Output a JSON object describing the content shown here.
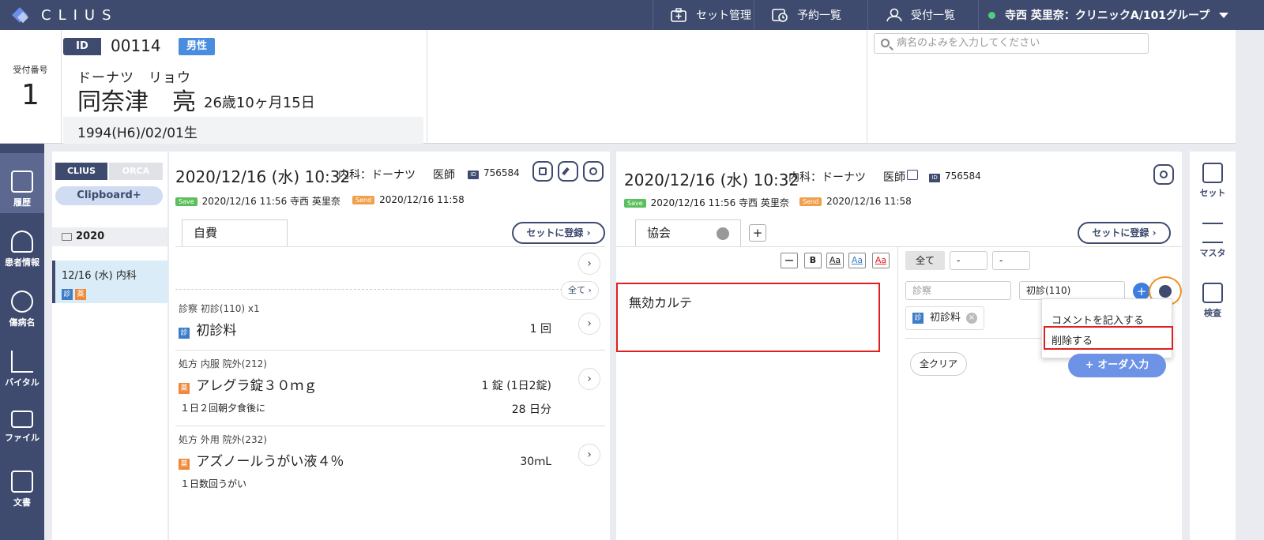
{
  "app": {
    "logo_text": "CLIUS"
  },
  "topnav": {
    "set_label": "セット管理",
    "yoyaku_label": "予約一覧",
    "uketsuke_label": "受付一覧",
    "user_label": "寺西 英里奈：クリニックA/101グループ"
  },
  "header": {
    "reception_label": "受付番号",
    "reception_number": "1",
    "id_label": "ID",
    "patient_id": "00114",
    "sex": "男性",
    "name_kana": "ドーナツ　リョウ",
    "name_kanji": "同奈津　亮",
    "age": "26歳10ヶ月15日",
    "dob": "1994(H6)/02/01生",
    "search_placeholder": "病名のよみを入力してください"
  },
  "left_sidebar": {
    "items": [
      {
        "label": "履歴",
        "icon": "history-icon"
      },
      {
        "label": "患者情報",
        "icon": "patient-info-icon"
      },
      {
        "label": "傷病名",
        "icon": "disease-icon"
      },
      {
        "label": "バイタル",
        "icon": "vitals-icon"
      },
      {
        "label": "ファイル",
        "icon": "folder-icon"
      },
      {
        "label": "文書",
        "icon": "document-icon"
      }
    ]
  },
  "history": {
    "tab_clius": "CLIUS",
    "tab_orca": "ORCA",
    "clipboard_label": "Clipboard+",
    "year": "2020",
    "entry_label": "12/16 (水) 内科",
    "badge_shin": "診",
    "badge_yaku": "薬"
  },
  "center": {
    "datetime": "2020/12/16 (水) 10:32",
    "dept": "内科：ドーナツ",
    "doctor": "医師",
    "id_badge": "ID",
    "id_value": "756584",
    "save_tag": "Save",
    "save_info": "2020/12/16 11:56 寺西 英里奈",
    "send_tag": "Send",
    "send_info": "2020/12/16 11:58",
    "insurance_tab": "自費",
    "register_set_label": "セットに登録",
    "all_label": "全て",
    "orders": [
      {
        "category": "診察 初診(110) x1",
        "badge": "診",
        "name": "初診料",
        "qty": "1 回",
        "note": "",
        "days": ""
      },
      {
        "category": "処方 内服 院外(212)",
        "badge": "薬",
        "name": "アレグラ錠３０ｍｇ",
        "qty": "1 錠 (1日2錠)",
        "note": "１日２回朝夕食後に",
        "days": "28 日分"
      },
      {
        "category": "処方 外用 院外(232)",
        "badge": "薬",
        "name": "アズノールうがい液４％",
        "qty": "30ｍL",
        "note": "１日数回うがい",
        "days": ""
      }
    ]
  },
  "right": {
    "datetime": "2020/12/16 (水) 10:32",
    "dept": "内科：ドーナツ",
    "doctor": "医師",
    "id_badge": "ID",
    "id_value": "756584",
    "save_tag": "Save",
    "save_info": "2020/12/16 11:56 寺西 英里奈",
    "send_tag": "Send",
    "send_info": "2020/12/16 11:58",
    "insurance_tab": "協会",
    "add_tab": "+",
    "register_set_label": "セットに登録",
    "toolbar": [
      "—",
      "B",
      "Aa",
      "Aa",
      "Aa"
    ],
    "karte_text": "無効カルテ",
    "filter_all": "全て",
    "filter_sel1": "-",
    "filter_sel2": "-",
    "order_type_placeholder": "診察",
    "order_item_select": "初診(110)",
    "chip_badge": "診",
    "chip_label": "初診料",
    "clear_label": "全クリア",
    "order_input_label": "+ オーダ入力",
    "menu_comment": "コメントを記入する",
    "menu_delete": "削除する"
  },
  "right_sidebar": {
    "items": [
      {
        "label": "セット",
        "icon": "set-icon"
      },
      {
        "label": "マスタ",
        "icon": "master-icon"
      },
      {
        "label": "検査",
        "icon": "exam-icon"
      }
    ]
  }
}
